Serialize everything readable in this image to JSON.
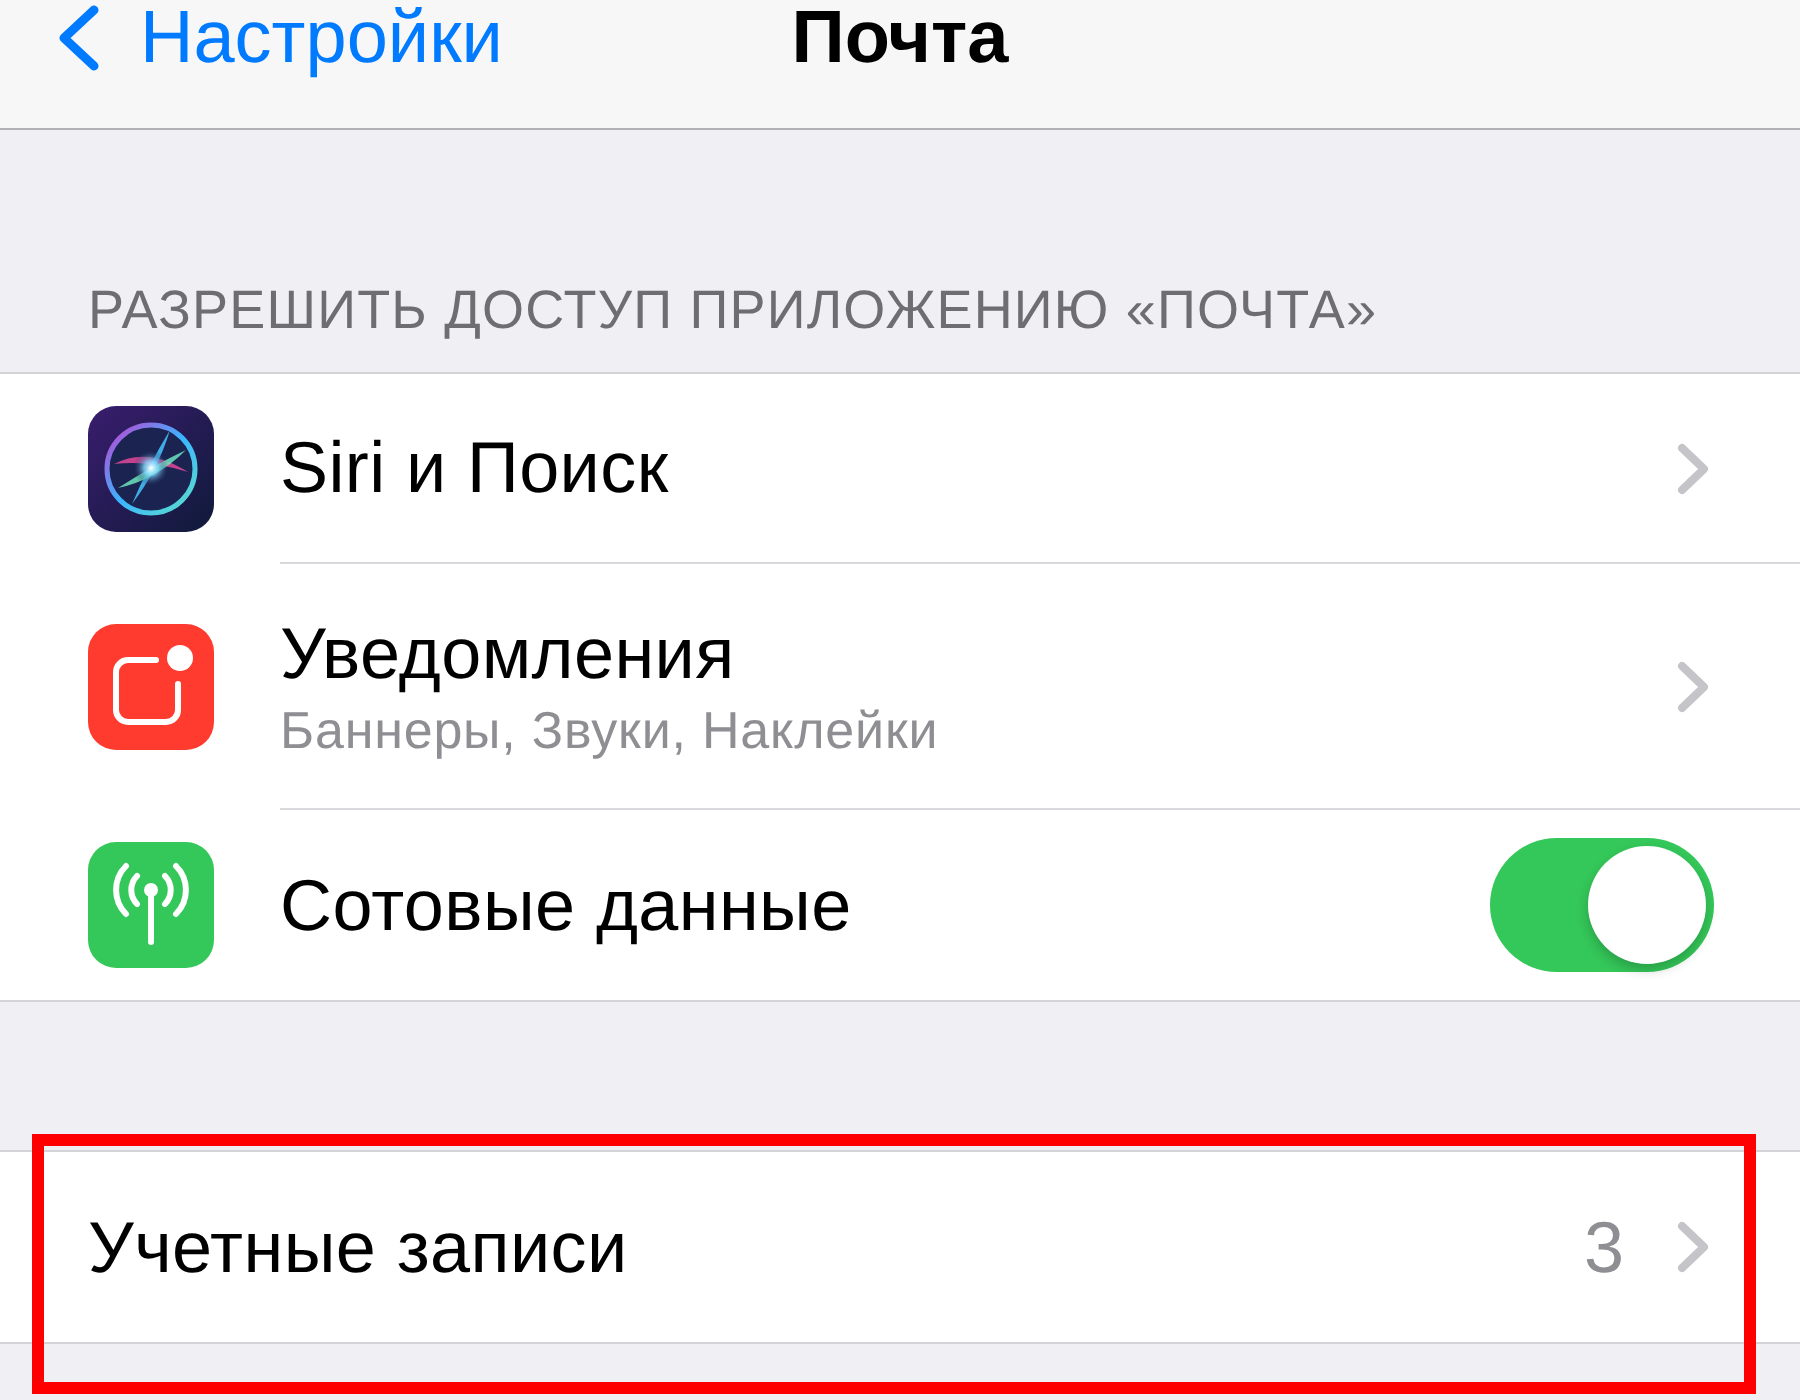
{
  "nav_bar": {
    "back_label": "Настройки",
    "title": "Почта"
  },
  "sections": [
    {
      "header": "РАЗРЕШИТЬ ДОСТУП ПРИЛОЖЕНИЮ «ПОЧТА»",
      "rows": [
        {
          "kind": "link",
          "title": "Siri и Поиск"
        },
        {
          "kind": "link",
          "title": "Уведомления",
          "subtitle": "Баннеры, Звуки, Наклейки"
        },
        {
          "kind": "toggle",
          "title": "Сотовые данные",
          "on": true
        }
      ]
    },
    {
      "rows": [
        {
          "kind": "link",
          "title": "Учетные записи",
          "value": "3",
          "highlighted": true
        }
      ]
    }
  ]
}
